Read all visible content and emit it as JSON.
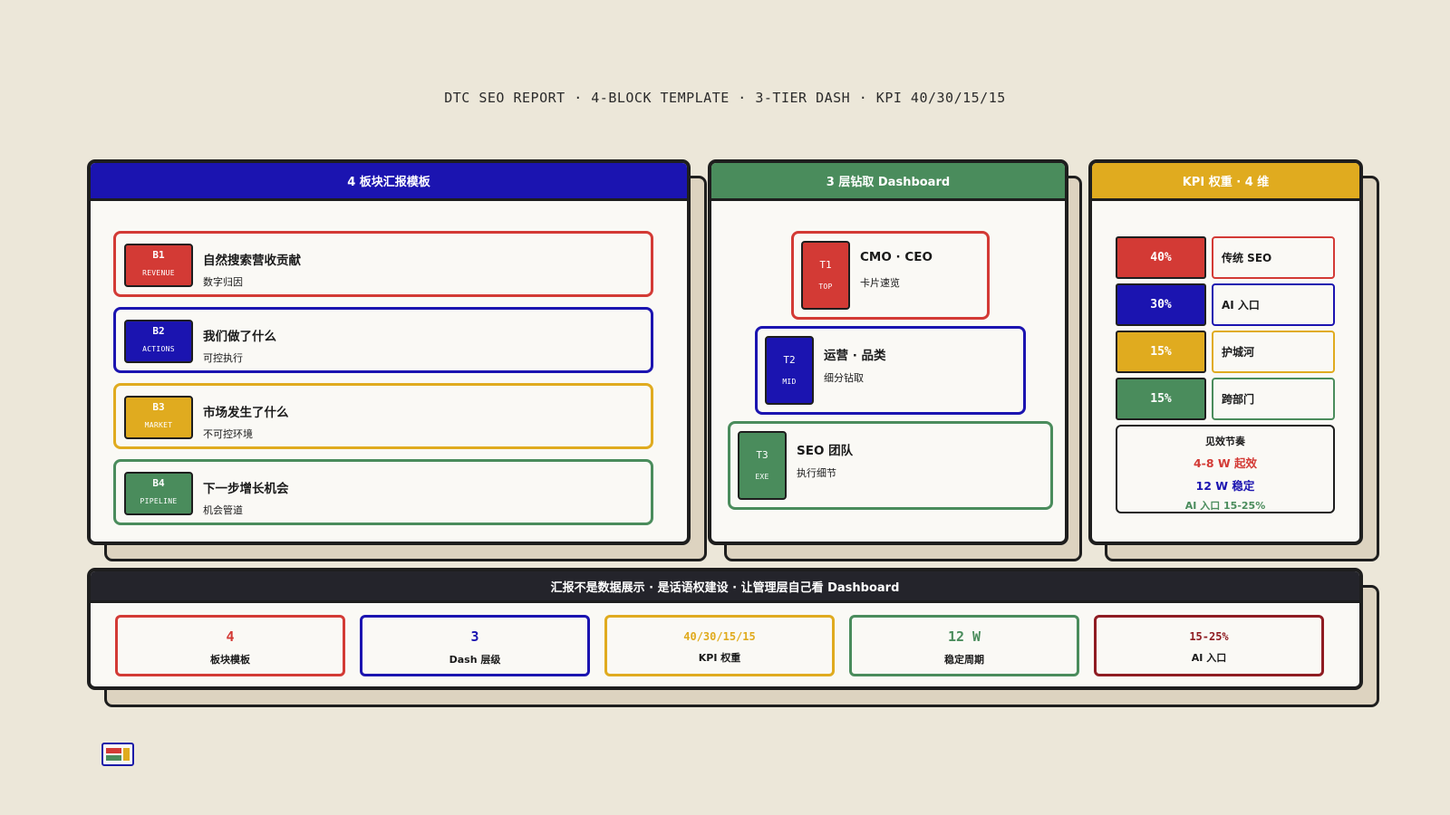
{
  "title": "DTC SEO REPORT · 4-BLOCK TEMPLATE · 3-TIER DASH · KPI 40/30/15/15",
  "colors": {
    "red": "#d33a35",
    "blue": "#1b14b0",
    "yellow": "#e0ab1f",
    "green": "#4a8c5c",
    "dark": "#24242b",
    "maroon": "#8f1c22",
    "bg": "#ece7d9"
  },
  "blocks_panel": {
    "header": "4 板块汇报模板",
    "items": [
      {
        "code": "B1",
        "tag": "REVENUE",
        "title": "自然搜索营收贡献",
        "sub": "数字归因"
      },
      {
        "code": "B2",
        "tag": "ACTIONS",
        "title": "我们做了什么",
        "sub": "可控执行"
      },
      {
        "code": "B3",
        "tag": "MARKET",
        "title": "市场发生了什么",
        "sub": "不可控环境"
      },
      {
        "code": "B4",
        "tag": "PIPELINE",
        "title": "下一步增长机会",
        "sub": "机会管道"
      }
    ]
  },
  "dash_panel": {
    "header": "3 层钻取 Dashboard",
    "tiers": [
      {
        "code": "T1",
        "tag": "TOP",
        "title": "CMO · CEO",
        "sub": "卡片速览"
      },
      {
        "code": "T2",
        "tag": "MID",
        "title": "运营 · 品类",
        "sub": "细分钻取"
      },
      {
        "code": "T3",
        "tag": "EXE",
        "title": "SEO 团队",
        "sub": "执行细节"
      }
    ]
  },
  "kpi_panel": {
    "header": "KPI 权重 · 4 维",
    "weights": [
      {
        "pct": "40%",
        "label": "传统 SEO"
      },
      {
        "pct": "30%",
        "label": "AI 入口"
      },
      {
        "pct": "15%",
        "label": "护城河"
      },
      {
        "pct": "15%",
        "label": "跨部门"
      }
    ],
    "rhythm": {
      "title": "见效节奏",
      "line1": "4-8 W 起效",
      "line2": "12 W 稳定",
      "line3": "AI 入口 15-25%"
    }
  },
  "summary": {
    "header": "汇报不是数据展示 · 是话语权建设 · 让管理层自己看 Dashboard",
    "stats": [
      {
        "value": "4",
        "label": "板块模板"
      },
      {
        "value": "3",
        "label": "Dash 层级"
      },
      {
        "value": "40/30/15/15",
        "label": "KPI 权重"
      },
      {
        "value": "12 W",
        "label": "稳定周期"
      },
      {
        "value": "15-25%",
        "label": "AI 入口"
      }
    ]
  }
}
